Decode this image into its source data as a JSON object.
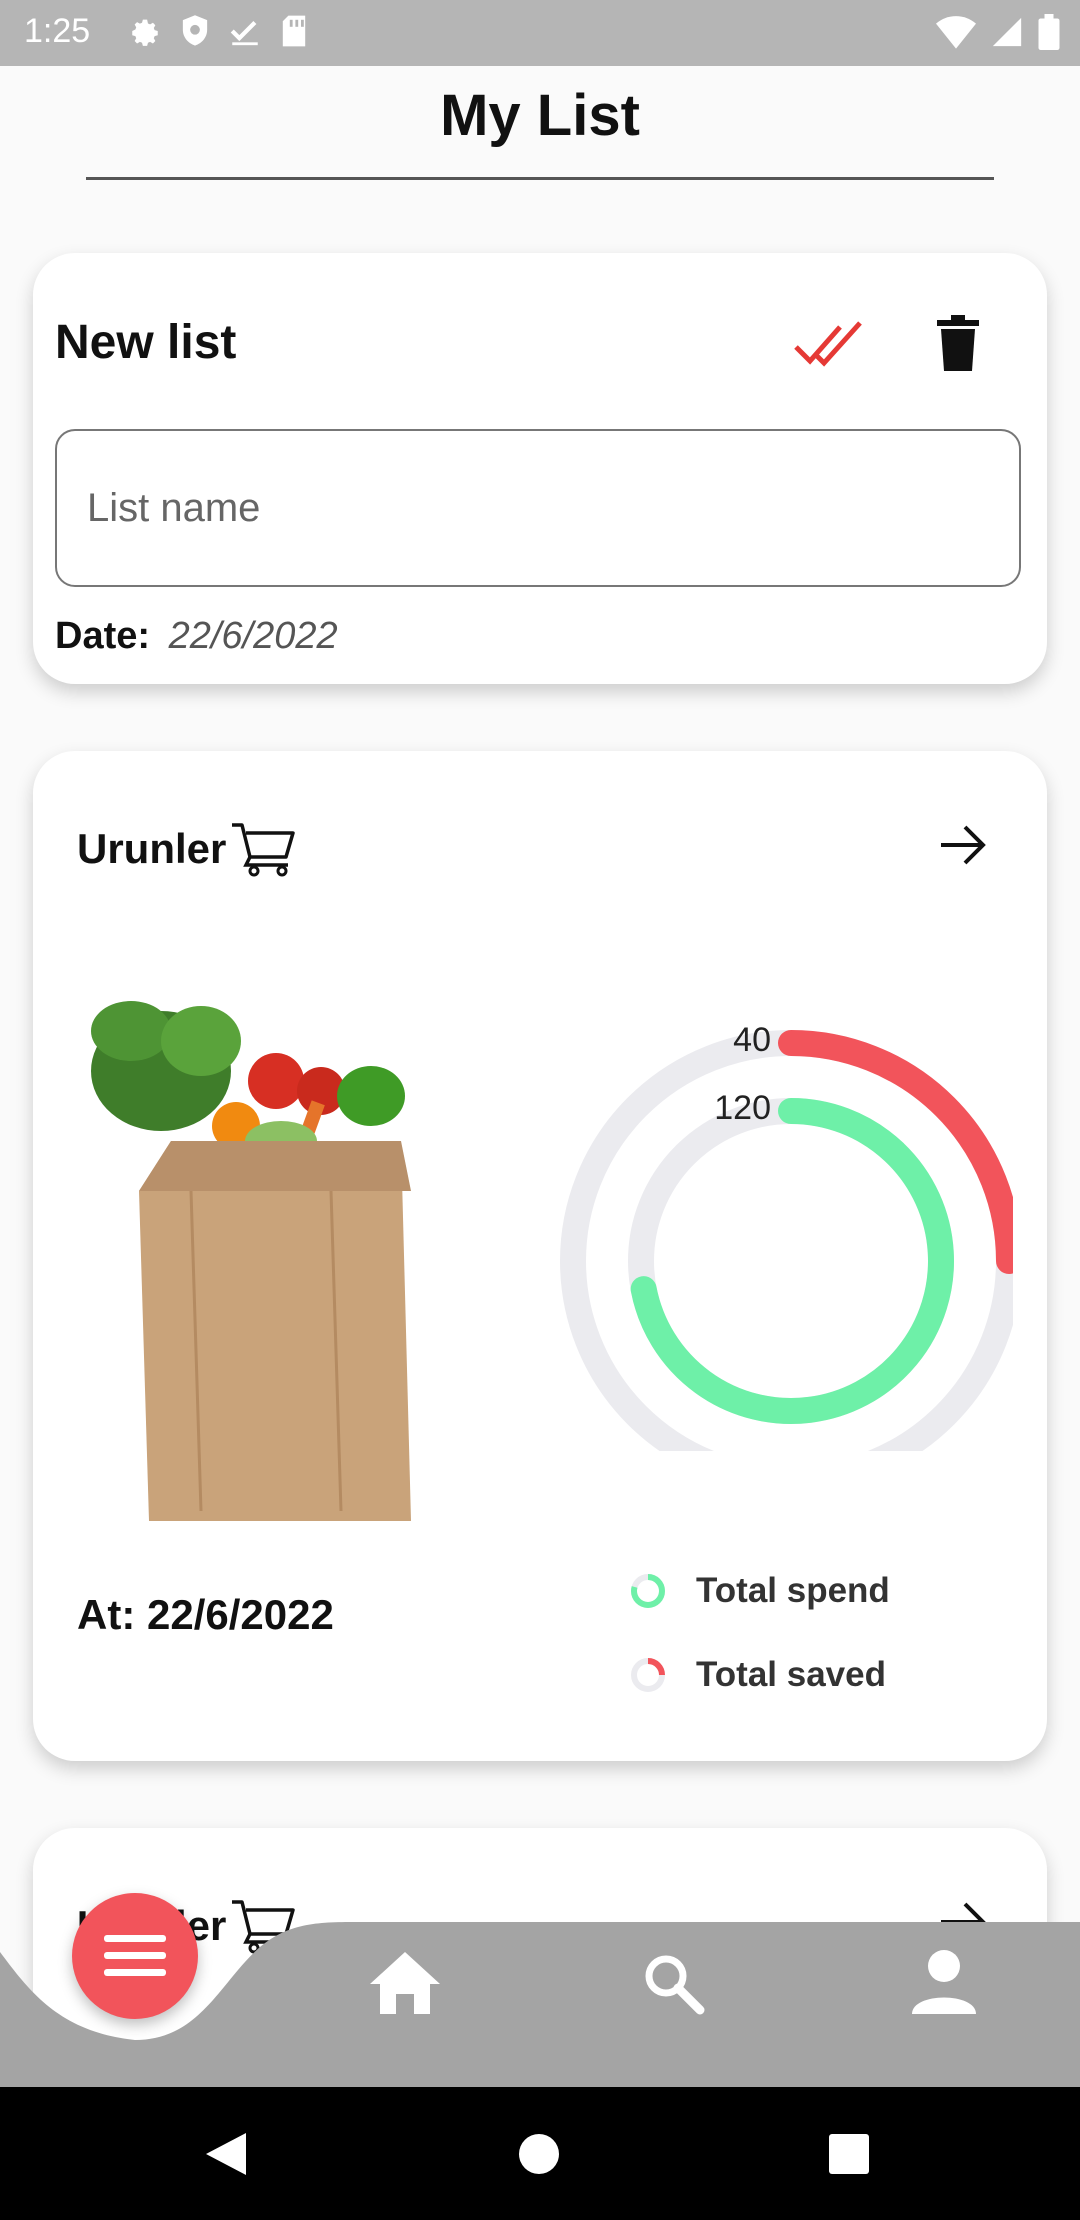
{
  "status_bar": {
    "time": "1:25",
    "left_icons": [
      "gear-icon",
      "shield-icon",
      "check-icon",
      "sd-card-icon"
    ],
    "right_icons": [
      "wifi-icon",
      "signal-icon",
      "battery-icon"
    ]
  },
  "page": {
    "title": "My List"
  },
  "new_list_card": {
    "title": "New list",
    "input_placeholder": "List name",
    "input_value": "",
    "date_label": "Date:",
    "date_value": "22/6/2022",
    "accent_color": "#e53935"
  },
  "lists": [
    {
      "name": "Urunler",
      "at_date": "At: 22/6/2022",
      "chart": {
        "outer_value_label": "40",
        "inner_value_label": "120",
        "outer_fraction": 0.25,
        "inner_fraction": 0.72,
        "outer_color": "#f2545b",
        "inner_color": "#6ef0a8",
        "track_color": "#ebebef"
      },
      "legend": [
        {
          "label": "Total spend",
          "color": "#6ef0a8"
        },
        {
          "label": "Total saved",
          "color": "#f2545b"
        }
      ]
    },
    {
      "name": "Urunler"
    }
  ],
  "bottom_nav": {
    "fab_icon": "menu-icon",
    "items": [
      "home-icon",
      "search-icon",
      "person-icon"
    ],
    "bar_color": "#a4a4a4",
    "fab_color": "#f2545b"
  },
  "system_nav": [
    "back-icon",
    "home-circle-icon",
    "recents-icon"
  ]
}
